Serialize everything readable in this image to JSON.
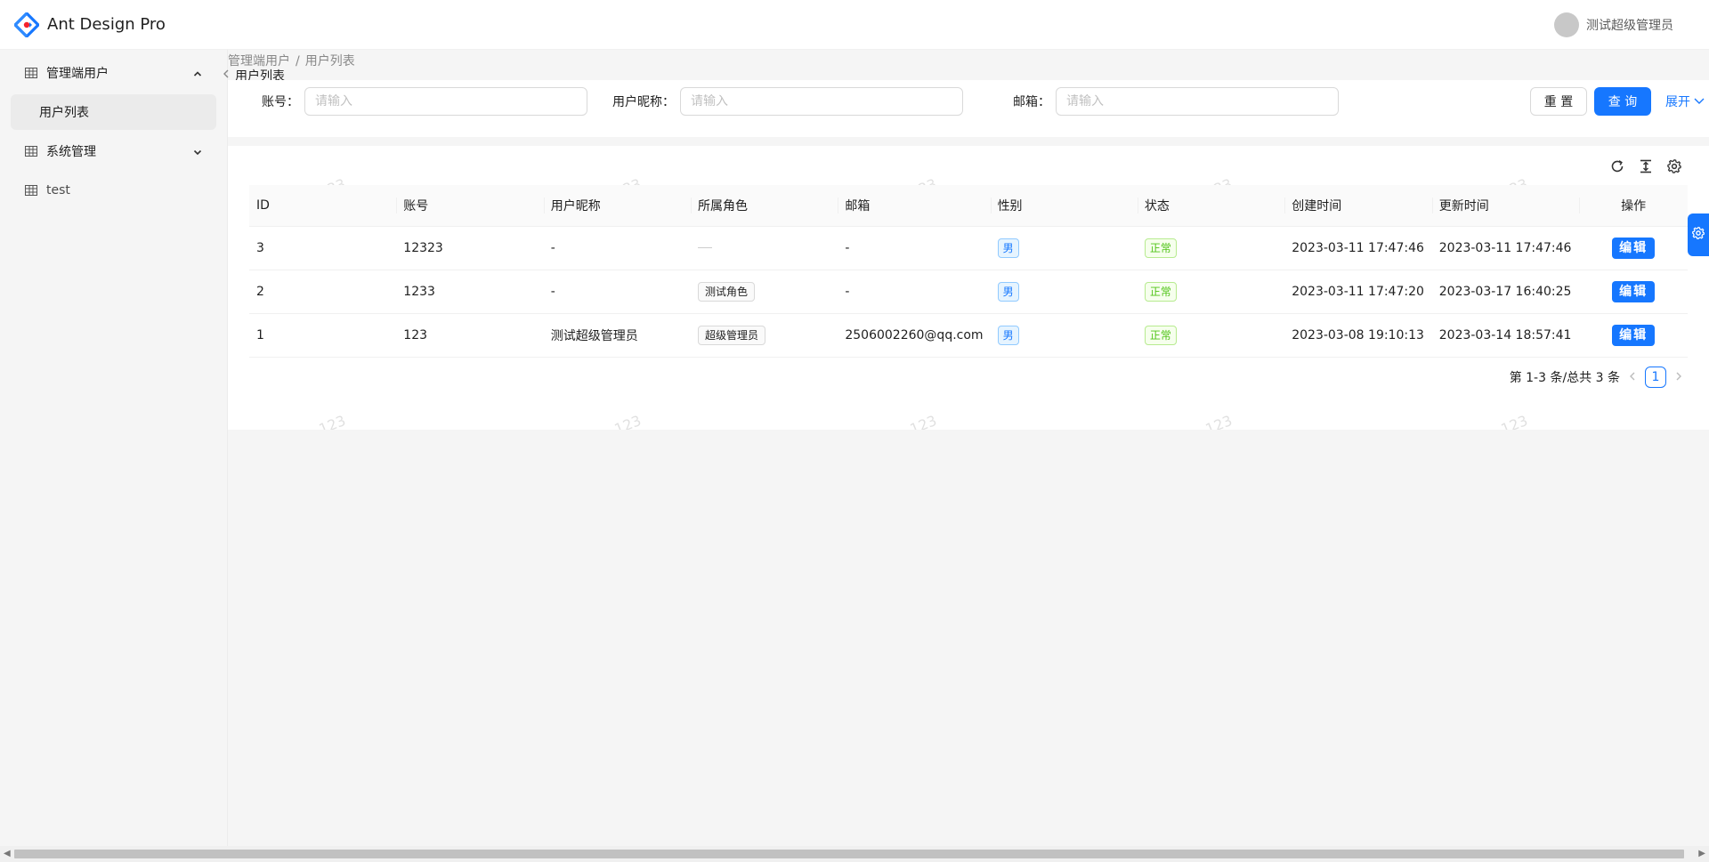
{
  "header": {
    "app_title": "Ant Design Pro",
    "user_name": "测试超级管理员"
  },
  "sidebar": {
    "items": [
      {
        "label": "管理端用户",
        "icon": "table-icon",
        "expanded": true,
        "children": [
          {
            "label": "用户列表",
            "selected": true
          }
        ]
      },
      {
        "label": "系统管理",
        "icon": "table-icon",
        "expanded": false
      },
      {
        "label": "test",
        "icon": "table-icon"
      }
    ]
  },
  "breadcrumb": {
    "items": [
      "管理端用户",
      "用户列表"
    ],
    "separator": "/"
  },
  "page": {
    "title": "用户列表"
  },
  "search": {
    "fields": [
      {
        "label": "账号：",
        "placeholder": "请输入",
        "value": ""
      },
      {
        "label": "用户昵称：",
        "placeholder": "请输入",
        "value": ""
      },
      {
        "label": "邮箱：",
        "placeholder": "请输入",
        "value": ""
      }
    ],
    "reset_label": "重 置",
    "query_label": "查 询",
    "expand_label": "展开"
  },
  "watermark": "123",
  "table": {
    "columns": [
      "ID",
      "账号",
      "用户昵称",
      "所属角色",
      "邮箱",
      "性别",
      "状态",
      "创建时间",
      "更新时间",
      "操作"
    ],
    "rows": [
      {
        "id": "3",
        "account": "12323",
        "nickname": "-",
        "role": "",
        "email": "-",
        "gender": "男",
        "status": "正常",
        "created": "2023-03-11 17:47:46",
        "updated": "2023-03-11 17:47:46",
        "action": "编辑"
      },
      {
        "id": "2",
        "account": "1233",
        "nickname": "-",
        "role": "测试角色",
        "email": "-",
        "gender": "男",
        "status": "正常",
        "created": "2023-03-11 17:47:20",
        "updated": "2023-03-17 16:40:25",
        "action": "编辑"
      },
      {
        "id": "1",
        "account": "123",
        "nickname": "测试超级管理员",
        "role": "超级管理员",
        "email": "2506002260@qq.com",
        "gender": "男",
        "status": "正常",
        "created": "2023-03-08 19:10:13",
        "updated": "2023-03-14 18:57:41",
        "action": "编辑"
      }
    ]
  },
  "pagination": {
    "summary": "第 1-3 条/总共 3 条",
    "current_page": "1"
  },
  "colors": {
    "primary": "#1677ff",
    "success": "#52c41a"
  }
}
